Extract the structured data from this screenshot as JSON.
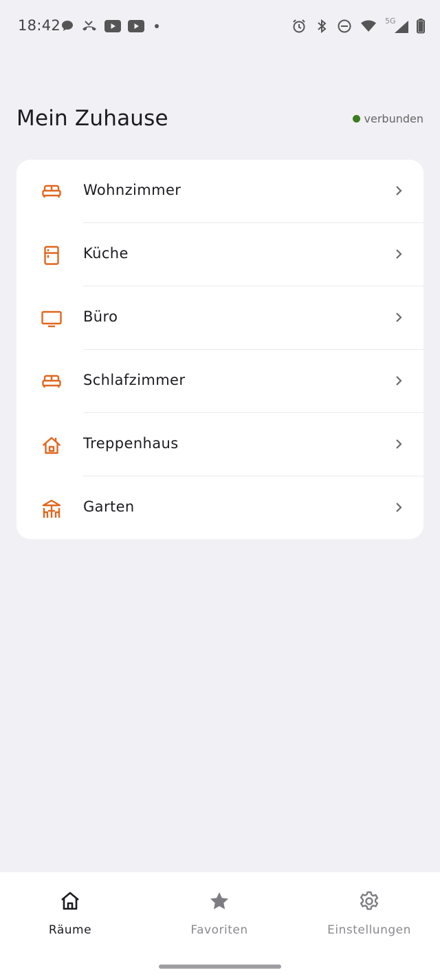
{
  "status_bar": {
    "time": "18:42",
    "left_icons": [
      "chat-bubble-icon",
      "missed-call-icon",
      "youtube-icon",
      "youtube-icon",
      "dot-icon"
    ],
    "right_icons": [
      "alarm-icon",
      "bluetooth-icon",
      "do-not-disturb-icon",
      "wifi-icon",
      "signal-5g-icon",
      "battery-icon"
    ],
    "network_label": "5G"
  },
  "header": {
    "title": "Mein Zuhause",
    "connection_status": "verbunden",
    "connection_color": "#3a7d1f"
  },
  "rooms": [
    {
      "label": "Wohnzimmer",
      "icon": "sofa-icon"
    },
    {
      "label": "Küche",
      "icon": "fridge-icon"
    },
    {
      "label": "Büro",
      "icon": "monitor-icon"
    },
    {
      "label": "Schlafzimmer",
      "icon": "sofa-icon"
    },
    {
      "label": "Treppenhaus",
      "icon": "house-icon"
    },
    {
      "label": "Garten",
      "icon": "garden-gazebo-icon"
    }
  ],
  "bottom_nav": [
    {
      "label": "Räume",
      "icon": "home-icon",
      "active": true
    },
    {
      "label": "Favoriten",
      "icon": "star-icon",
      "active": false
    },
    {
      "label": "Einstellungen",
      "icon": "gear-icon",
      "active": false
    }
  ],
  "colors": {
    "accent": "#e0661f",
    "background": "#f1f0f5",
    "card": "#ffffff",
    "nav_active": "#1c1b20",
    "nav_inactive": "#8a898f"
  }
}
